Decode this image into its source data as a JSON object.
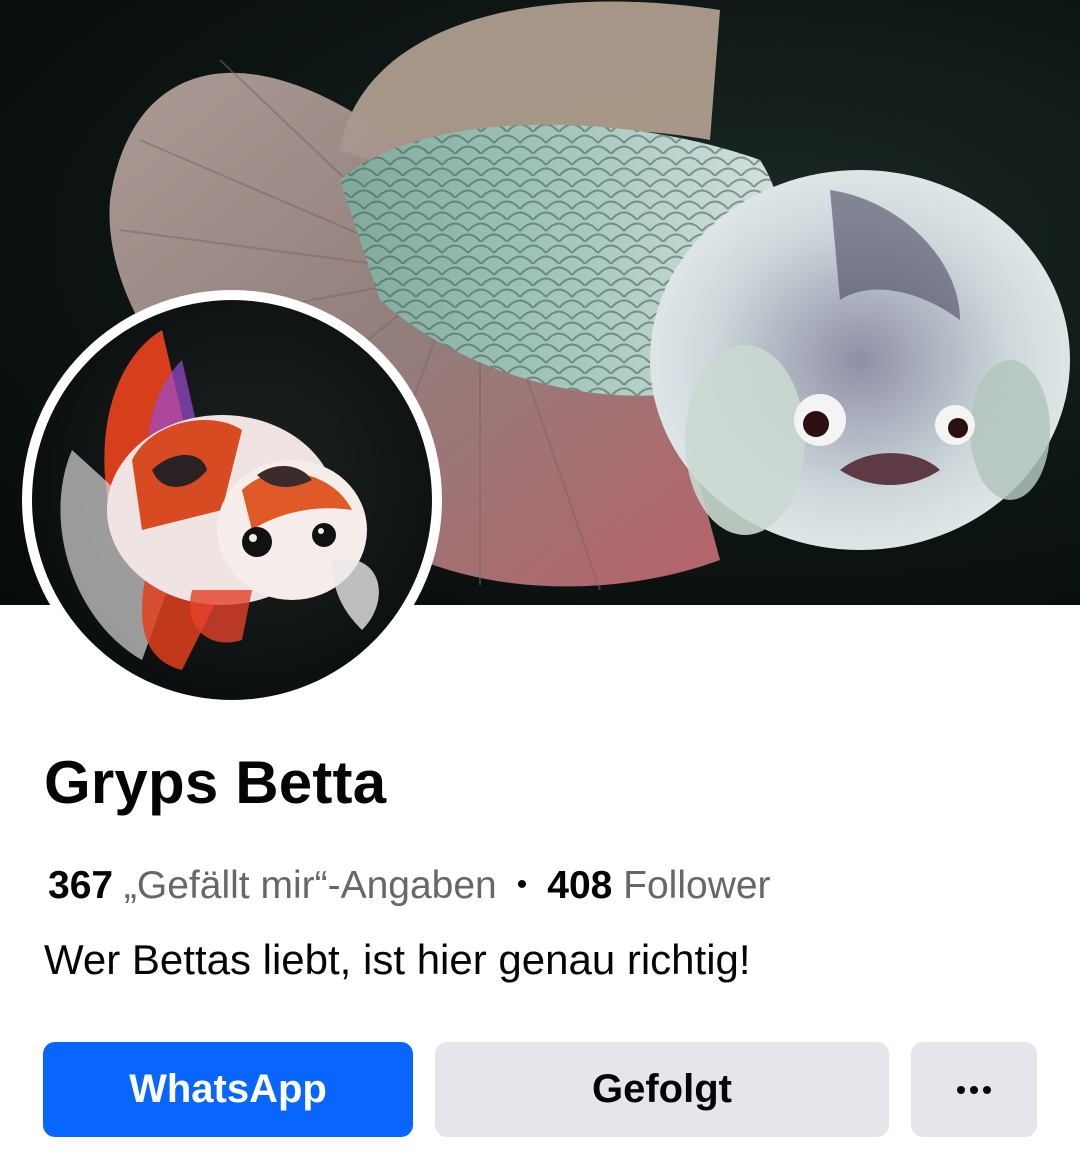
{
  "profile": {
    "name": "Gryps Betta",
    "likes_count": "367",
    "likes_label": "„Gefällt mir“-Angaben",
    "separator": "•",
    "followers_count": "408",
    "followers_label": "Follower",
    "bio": "Wer Bettas liebt, ist hier genau richtig!"
  },
  "actions": {
    "primary_label": "WhatsApp",
    "follow_label": "Gefolgt",
    "more_icon": "more-dots-icon"
  },
  "colors": {
    "primary": "#0866ff",
    "secondary_bg": "#e4e6eb",
    "text": "#050505",
    "muted": "#65676b"
  }
}
